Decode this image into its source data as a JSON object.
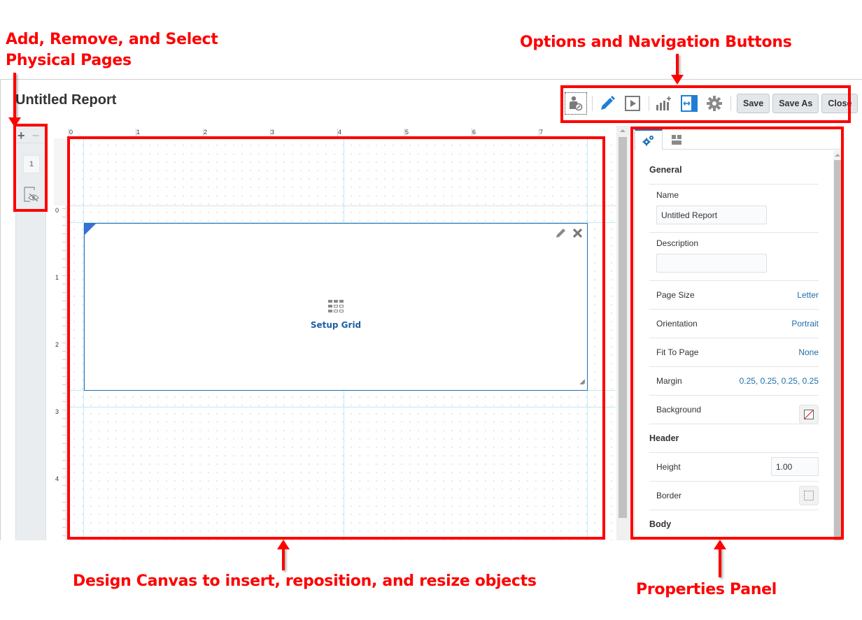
{
  "annotations": {
    "pages": "Add, Remove, and Select\nPhysical Pages",
    "pages_line1": "Add, Remove, and Select",
    "pages_line2": "Physical Pages",
    "toolbar": "Options and Navigation Buttons",
    "canvas": "Design Canvas to insert, reposition, and resize objects",
    "properties": "Properties Panel",
    "highlight_color": "#ff0000"
  },
  "report": {
    "title": "Untitled Report"
  },
  "toolbar": {
    "icons": [
      "user-permissions-icon",
      "edit-pencil-icon",
      "preview-play-icon",
      "add-chart-icon",
      "fit-width-icon",
      "settings-gear-icon"
    ],
    "save_label": "Save",
    "save_as_label": "Save As",
    "close_label": "Close"
  },
  "pages": {
    "add_label": "+",
    "remove_label": "−",
    "items": [
      {
        "label": "1"
      }
    ]
  },
  "ruler": {
    "top_labels": [
      "0",
      "1",
      "2",
      "3",
      "4",
      "5",
      "6",
      "7"
    ],
    "left_labels": [
      "0",
      "0",
      "1",
      "2",
      "3",
      "4"
    ]
  },
  "canvas": {
    "grid_object": {
      "action_label": "Setup Grid"
    }
  },
  "properties": {
    "tabs": [
      "settings-tab",
      "layout-tab"
    ],
    "sections": {
      "general": "General",
      "header": "Header",
      "body": "Body"
    },
    "fields": {
      "name": {
        "label": "Name",
        "value": "Untitled Report"
      },
      "description": {
        "label": "Description",
        "value": ""
      },
      "page_size": {
        "label": "Page Size",
        "value": "Letter"
      },
      "orientation": {
        "label": "Orientation",
        "value": "Portrait"
      },
      "fit_to_page": {
        "label": "Fit To Page",
        "value": "None"
      },
      "margin": {
        "label": "Margin",
        "value": "0.25, 0.25, 0.25, 0.25"
      },
      "background": {
        "label": "Background"
      },
      "header_height": {
        "label": "Height",
        "value": "1.00"
      },
      "header_border": {
        "label": "Border"
      }
    },
    "accent_color": "#1f6fb5",
    "link_color": "#1f6fa8"
  }
}
